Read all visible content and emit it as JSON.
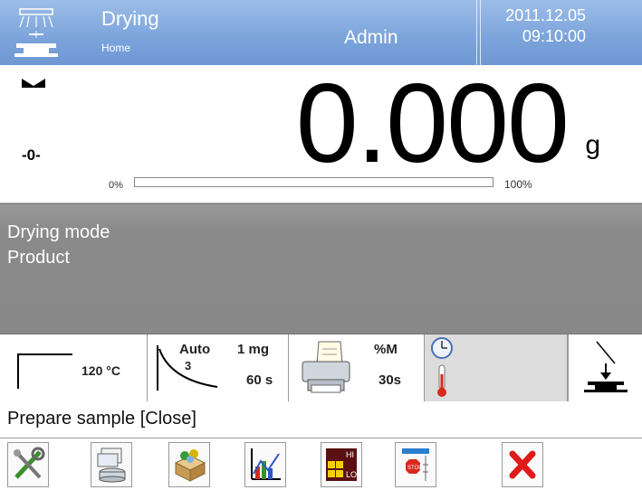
{
  "header": {
    "mode_title": "Drying",
    "screen_name": "Home",
    "user": "Admin",
    "date": "2011.12.05",
    "time": "09:10:00",
    "mode_icon": "drying-lamp-icon"
  },
  "weighing": {
    "value": "0.000",
    "unit": "g",
    "zero_indicator": "-0-",
    "stability_icon": "stability-marker-icon",
    "bar_min_label": "0%",
    "bar_max_label": "100%",
    "bar_fill_fraction": 0
  },
  "info": {
    "line1": "Drying mode",
    "line2": "Product"
  },
  "params": {
    "temperature": "120 °C",
    "finish_mode": "Auto",
    "finish_mode_value": "3",
    "mass_threshold": "1 mg",
    "time_interval": "60 s",
    "print_mode": "%M",
    "print_interval": "30s"
  },
  "prompt": {
    "text": "Prepare sample [Close]"
  },
  "toolbar": {
    "icons": [
      "tools-icon",
      "database-icon",
      "products-icon",
      "chart-icon",
      "threshold-icon",
      "stop-icon",
      "cancel-icon"
    ]
  },
  "colors": {
    "header_bg": "#7ba3db",
    "info_bg": "#8a8a8a",
    "cancel_red": "#e0191a"
  }
}
